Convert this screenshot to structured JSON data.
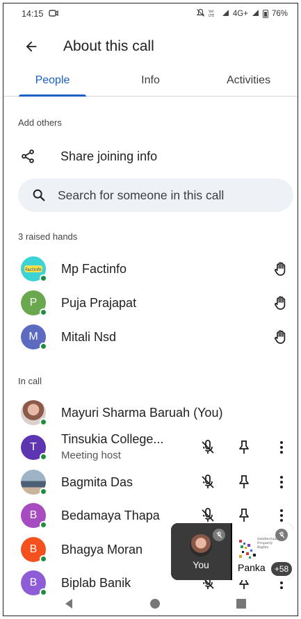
{
  "status_bar": {
    "time": "14:15",
    "network": "4G+",
    "battery": "76%"
  },
  "header": {
    "title": "About this call"
  },
  "tabs": [
    {
      "label": "People",
      "active": true
    },
    {
      "label": "Info",
      "active": false
    },
    {
      "label": "Activities",
      "active": false
    }
  ],
  "add_others": {
    "heading": "Add others",
    "share_label": "Share joining info"
  },
  "search": {
    "placeholder": "Search for someone in this call"
  },
  "raised_hands": {
    "heading": "3 raised hands",
    "people": [
      {
        "name": "Mp Factinfo",
        "initial": "",
        "color": "#3bd3d6"
      },
      {
        "name": "Puja Prajapat",
        "initial": "P",
        "color": "#6aa84f"
      },
      {
        "name": "Mitali Nsd",
        "initial": "M",
        "color": "#5c6bc0"
      }
    ]
  },
  "in_call": {
    "heading": "In call",
    "people": [
      {
        "name": "Mayuri Sharma Baruah (You)",
        "initial": "",
        "color": "#c98f7c"
      },
      {
        "name": "Tinsukia College...",
        "subtitle": "Meeting host",
        "initial": "T",
        "color": "#5e35b1"
      },
      {
        "name": "Bagmita Das",
        "initial": "",
        "color": "#7b93a8"
      },
      {
        "name": "Bedamaya Thapa",
        "initial": "B",
        "color": "#a64bc0"
      },
      {
        "name": "Bhagya Moran",
        "initial": "B",
        "color": "#f4511e"
      },
      {
        "name": "Biplab Banik",
        "initial": "B",
        "color": "#8e5cd6"
      }
    ]
  },
  "pip": {
    "self_label": "You",
    "other_label": "Panka",
    "more_count": "+58",
    "slide_text": "Intellectual Property Rights"
  },
  "colors": {
    "accent": "#1a5fc6",
    "online": "#1e8e3e",
    "search_bg": "#eef2f7"
  }
}
